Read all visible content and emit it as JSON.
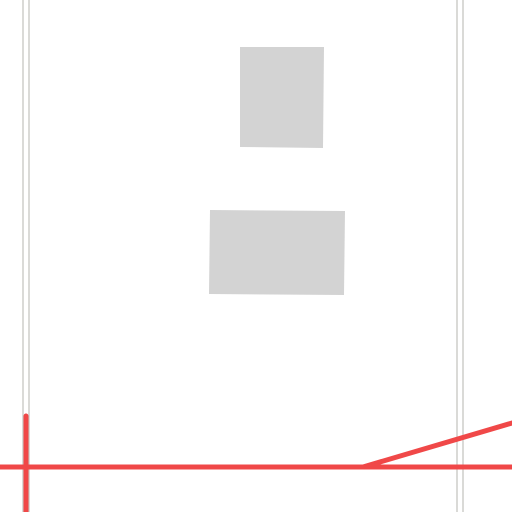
{
  "colors": {
    "background": "#ffffff",
    "page_border": "#d9d9d6",
    "page_border_inner": "#ecece9",
    "placeholder_fill": "#d3d3d3",
    "accent_line": "#f04848"
  },
  "blocks": [
    {
      "name": "placeholder-image-top",
      "icon": "image-placeholder"
    },
    {
      "name": "placeholder-image-bottom",
      "icon": "image-placeholder"
    }
  ],
  "annotations": [
    {
      "name": "red-horizontal-line",
      "icon": "line-annotation"
    },
    {
      "name": "red-vertical-line",
      "icon": "line-annotation"
    },
    {
      "name": "red-diagonal-line",
      "icon": "line-annotation"
    }
  ]
}
